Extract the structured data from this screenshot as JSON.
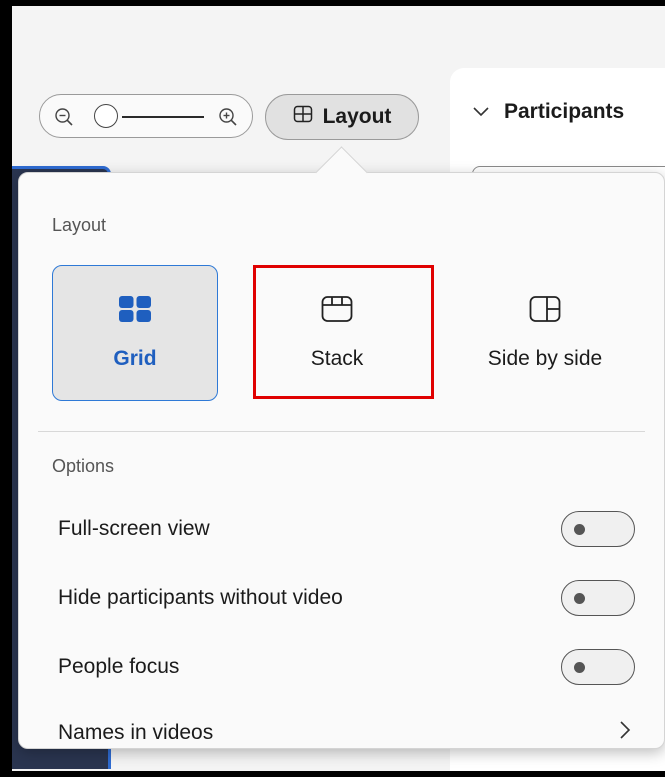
{
  "toolbar": {
    "layout_button_label": "Layout"
  },
  "participants": {
    "title": "Participants"
  },
  "popover": {
    "layout_section_label": "Layout",
    "layout_options": [
      {
        "label": "Grid",
        "selected": true
      },
      {
        "label": "Stack",
        "selected": false
      },
      {
        "label": "Side by side",
        "selected": false
      }
    ],
    "options_section_label": "Options",
    "options": [
      {
        "label": "Full-screen view",
        "type": "toggle",
        "on": false
      },
      {
        "label": "Hide participants without video",
        "type": "toggle",
        "on": false
      },
      {
        "label": "People focus",
        "type": "toggle",
        "on": false
      },
      {
        "label": "Names in videos",
        "type": "submenu"
      }
    ]
  },
  "colors": {
    "accent": "#2e79d6",
    "highlight": "#e00000",
    "background": "#f4f4f4"
  }
}
